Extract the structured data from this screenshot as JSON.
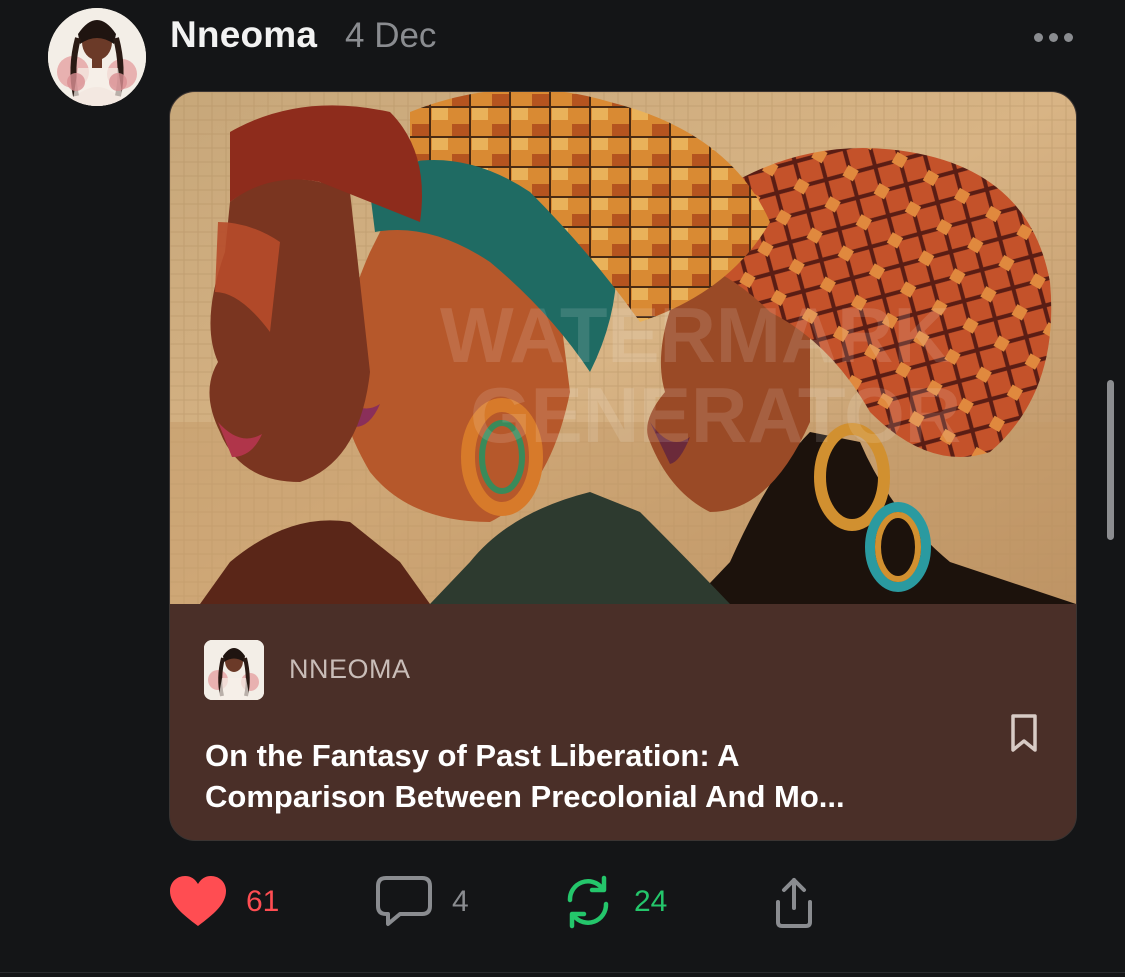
{
  "post": {
    "author": "Nneoma",
    "date": "4 Dec"
  },
  "card": {
    "publication": "NNEOMA",
    "title_line_1": "On the Fantasy of Past Liberation: A",
    "title_line_2": "Comparison Between Precolonial And Mo..."
  },
  "actions": {
    "likes": "61",
    "comments": "4",
    "restacks": "24"
  },
  "icons": {
    "more": "more-horizontal-icon",
    "bookmark": "bookmark-icon",
    "like": "heart-icon",
    "comment": "comment-icon",
    "restack": "restack-icon",
    "share": "share-icon"
  },
  "colors": {
    "background": "#141517",
    "card_footer": "#4a2f28",
    "like": "#ff4d52",
    "restack": "#24c66b",
    "muted": "#8a8c90"
  }
}
